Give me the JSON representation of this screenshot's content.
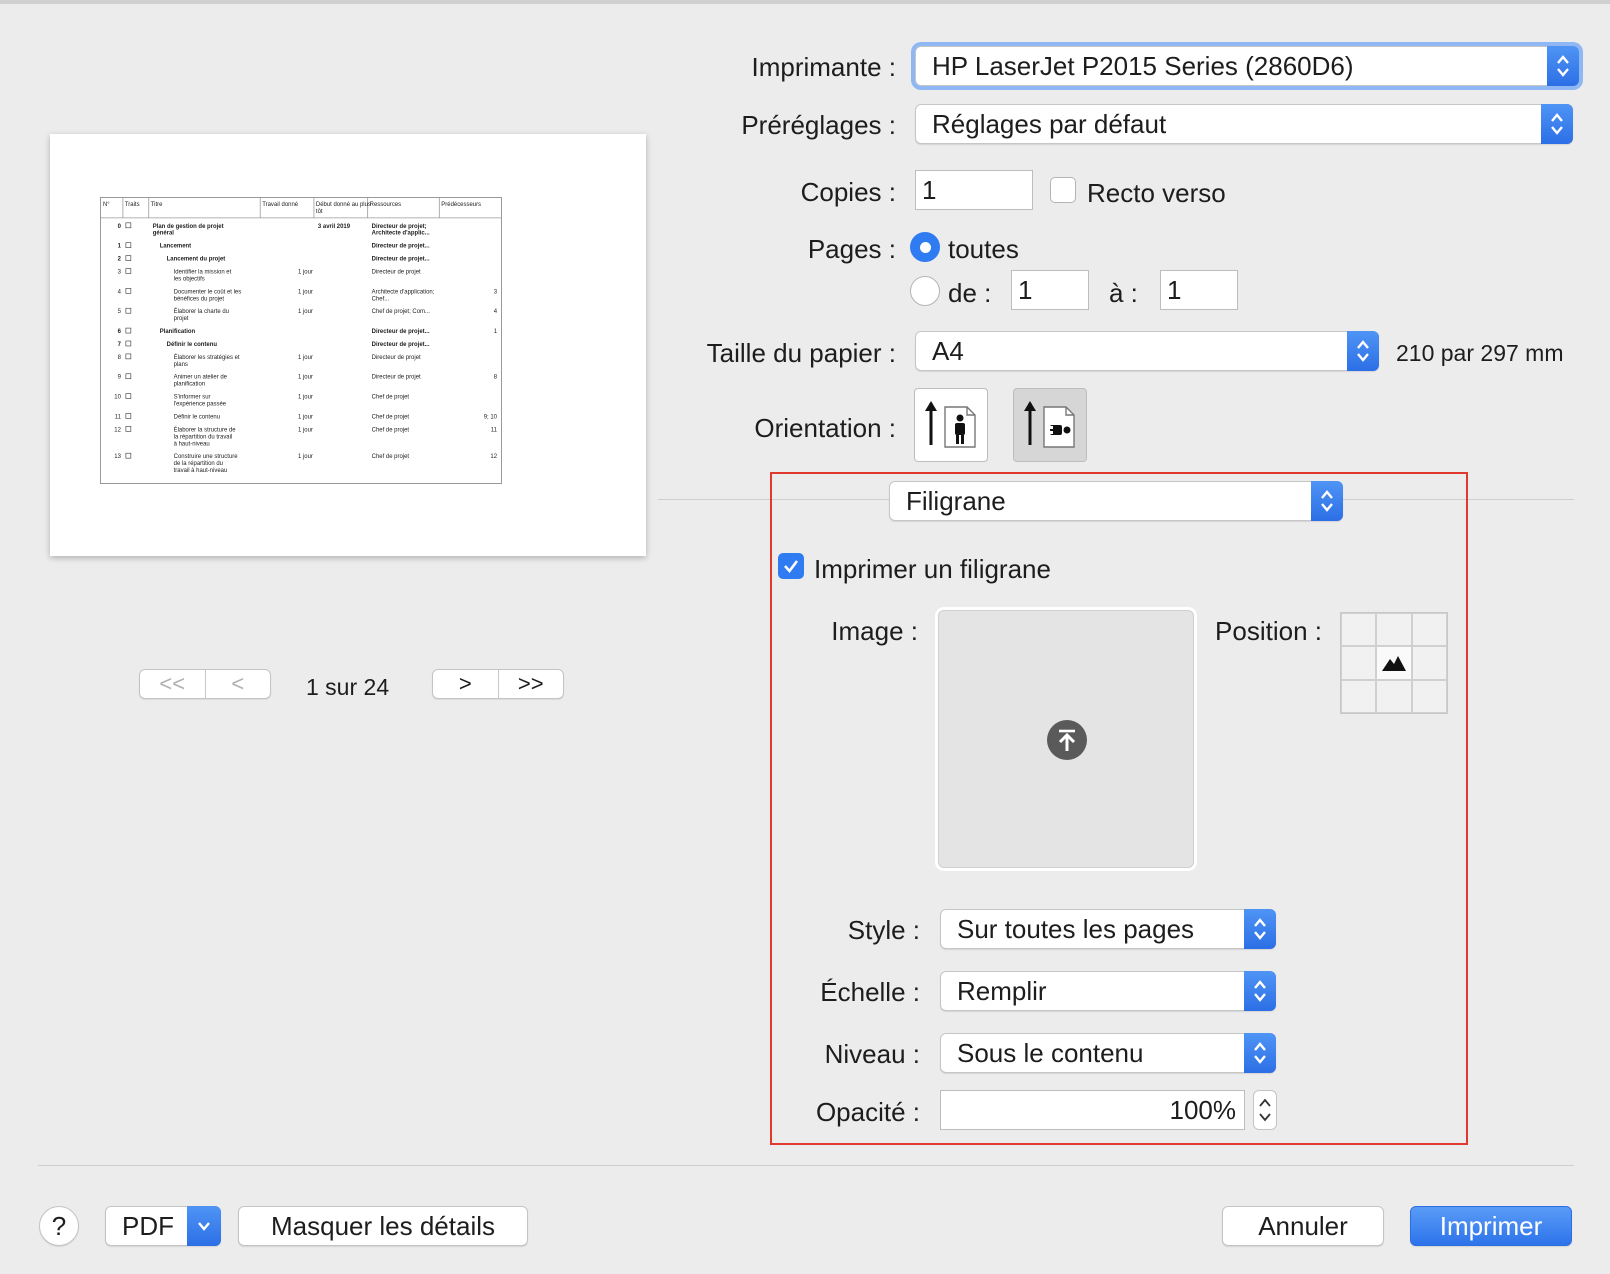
{
  "preview": {
    "headers": [
      "N°",
      "Traits",
      "Titre",
      "Travail donné",
      "Début donné au plus tôt",
      "Ressources",
      "Prédécesseurs"
    ],
    "rows": [
      {
        "n": "0",
        "title": "Plan de gestion de projet général",
        "work": "",
        "start": "3 avril 2019",
        "res": "Directeur de projet; Architecte d'applic...",
        "pred": "",
        "bold": true,
        "indent": 0
      },
      {
        "n": "1",
        "title": "Lancement",
        "work": "",
        "start": "",
        "res": "Directeur de projet...",
        "pred": "",
        "bold": true,
        "indent": 1
      },
      {
        "n": "2",
        "title": "Lancement du projet",
        "work": "",
        "start": "",
        "res": "Directeur de projet...",
        "pred": "",
        "bold": true,
        "indent": 2
      },
      {
        "n": "3",
        "title": "Identifier la mission et les objectifs",
        "work": "1 jour",
        "start": "",
        "res": "Directeur de projet",
        "pred": "",
        "bold": false,
        "indent": 3
      },
      {
        "n": "4",
        "title": "Documenter le coût et les bénéfices du projet",
        "work": "1 jour",
        "start": "",
        "res": "Architecte d'application; Chef...",
        "pred": "3",
        "bold": false,
        "indent": 3
      },
      {
        "n": "5",
        "title": "Élaborer la charte du projet",
        "work": "1 jour",
        "start": "",
        "res": "Chef de projet; Com...",
        "pred": "4",
        "bold": false,
        "indent": 3
      },
      {
        "n": "6",
        "title": "Planification",
        "work": "",
        "start": "",
        "res": "Directeur de projet...",
        "pred": "1",
        "bold": true,
        "indent": 1
      },
      {
        "n": "7",
        "title": "Définir le contenu",
        "work": "",
        "start": "",
        "res": "Directeur de projet...",
        "pred": "",
        "bold": true,
        "indent": 2
      },
      {
        "n": "8",
        "title": "Élaborer les stratégies et plans",
        "work": "1 jour",
        "start": "",
        "res": "Directeur de projet",
        "pred": "",
        "bold": false,
        "indent": 3
      },
      {
        "n": "9",
        "title": "Animer un atelier de planification",
        "work": "1 jour",
        "start": "",
        "res": "Directeur de projet",
        "pred": "8",
        "bold": false,
        "indent": 3
      },
      {
        "n": "10",
        "title": "S'informer sur l'expérience passée",
        "work": "1 jour",
        "start": "",
        "res": "Chef de projet",
        "pred": "",
        "bold": false,
        "indent": 3
      },
      {
        "n": "11",
        "title": "Définir le contenu",
        "work": "1 jour",
        "start": "",
        "res": "Chef de projet",
        "pred": "9; 10",
        "bold": false,
        "indent": 3
      },
      {
        "n": "12",
        "title": "Élaborer la structure de la répartition du travail à haut-niveau",
        "work": "1 jour",
        "start": "",
        "res": "Chef de projet",
        "pred": "11",
        "bold": false,
        "indent": 3
      },
      {
        "n": "13",
        "title": "Construire une structure de la répartition du travail à haut-niveau",
        "work": "1 jour",
        "start": "",
        "res": "Chef de projet",
        "pred": "12",
        "bold": false,
        "indent": 3
      }
    ]
  },
  "pager": {
    "text": "1 sur 24",
    "first": "<<",
    "prev": "<",
    "next": ">",
    "last": ">>"
  },
  "printer": {
    "label": "Imprimante :",
    "value": "HP LaserJet P2015 Series (2860D6)"
  },
  "presets": {
    "label": "Préréglages :",
    "value": "Réglages par défaut"
  },
  "copies": {
    "label": "Copies :",
    "value": "1",
    "duplex_label": "Recto verso",
    "duplex_checked": false
  },
  "pages": {
    "label": "Pages :",
    "all_label": "toutes",
    "from_label": "de :",
    "from_value": "1",
    "to_label": "à :",
    "to_value": "1",
    "selected": "all"
  },
  "paper": {
    "label": "Taille du papier :",
    "value": "A4",
    "dimensions": "210 par 297 mm"
  },
  "orientation": {
    "label": "Orientation :",
    "selected": "landscape"
  },
  "section": {
    "value": "Filigrane"
  },
  "watermark": {
    "enable_label": "Imprimer un filigrane",
    "enabled": true,
    "image_label": "Image :",
    "position_label": "Position :",
    "position_selected": "center",
    "style_label": "Style :",
    "style_value": "Sur toutes les pages",
    "scale_label": "Échelle :",
    "scale_value": "Remplir",
    "level_label": "Niveau :",
    "level_value": "Sous le contenu",
    "opacity_label": "Opacité :",
    "opacity_value": "100%"
  },
  "footer": {
    "help": "?",
    "pdf": "PDF",
    "hide_details": "Masquer les détails",
    "cancel": "Annuler",
    "print": "Imprimer"
  },
  "colors": {
    "accent": "#2f7bf2",
    "highlight_box": "#e0392e",
    "background": "#ececec"
  }
}
